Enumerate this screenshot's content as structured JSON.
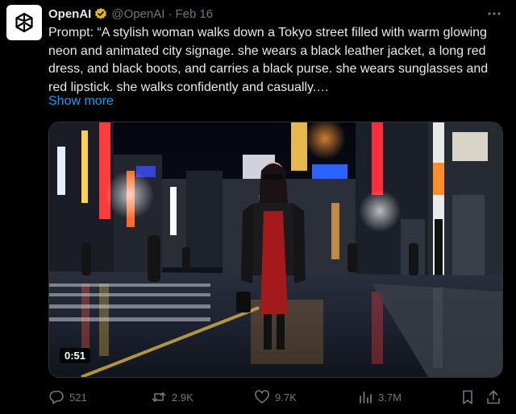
{
  "author": {
    "display_name": "OpenAI",
    "handle": "@OpenAI",
    "separator": "·",
    "date": "Feb 16"
  },
  "post": {
    "text": "Prompt: “A stylish woman walks down a Tokyo street filled with warm glowing neon and animated city signage. she wears a black leather jacket, a long red dress, and black boots, and carries a black purse. she wears sunglasses and red lipstick. she walks confidently and casually.…",
    "show_more_label": "Show more"
  },
  "media": {
    "duration": "0:51"
  },
  "metrics": {
    "replies": "521",
    "reposts": "2.9K",
    "likes": "9.7K",
    "views": "3.7M"
  },
  "icons": {
    "avatar": "openai-logo-icon",
    "verified": "gold-verified-badge-icon",
    "more": "more-options-icon",
    "reply": "reply-icon",
    "repost": "repost-icon",
    "like": "heart-icon",
    "views": "views-chart-icon",
    "bookmark": "bookmark-icon",
    "share": "share-icon"
  },
  "colors": {
    "background": "#000000",
    "text": "#e7e9ea",
    "muted": "#71767b",
    "link": "#1d9bf0",
    "verified": "#e2b719"
  }
}
